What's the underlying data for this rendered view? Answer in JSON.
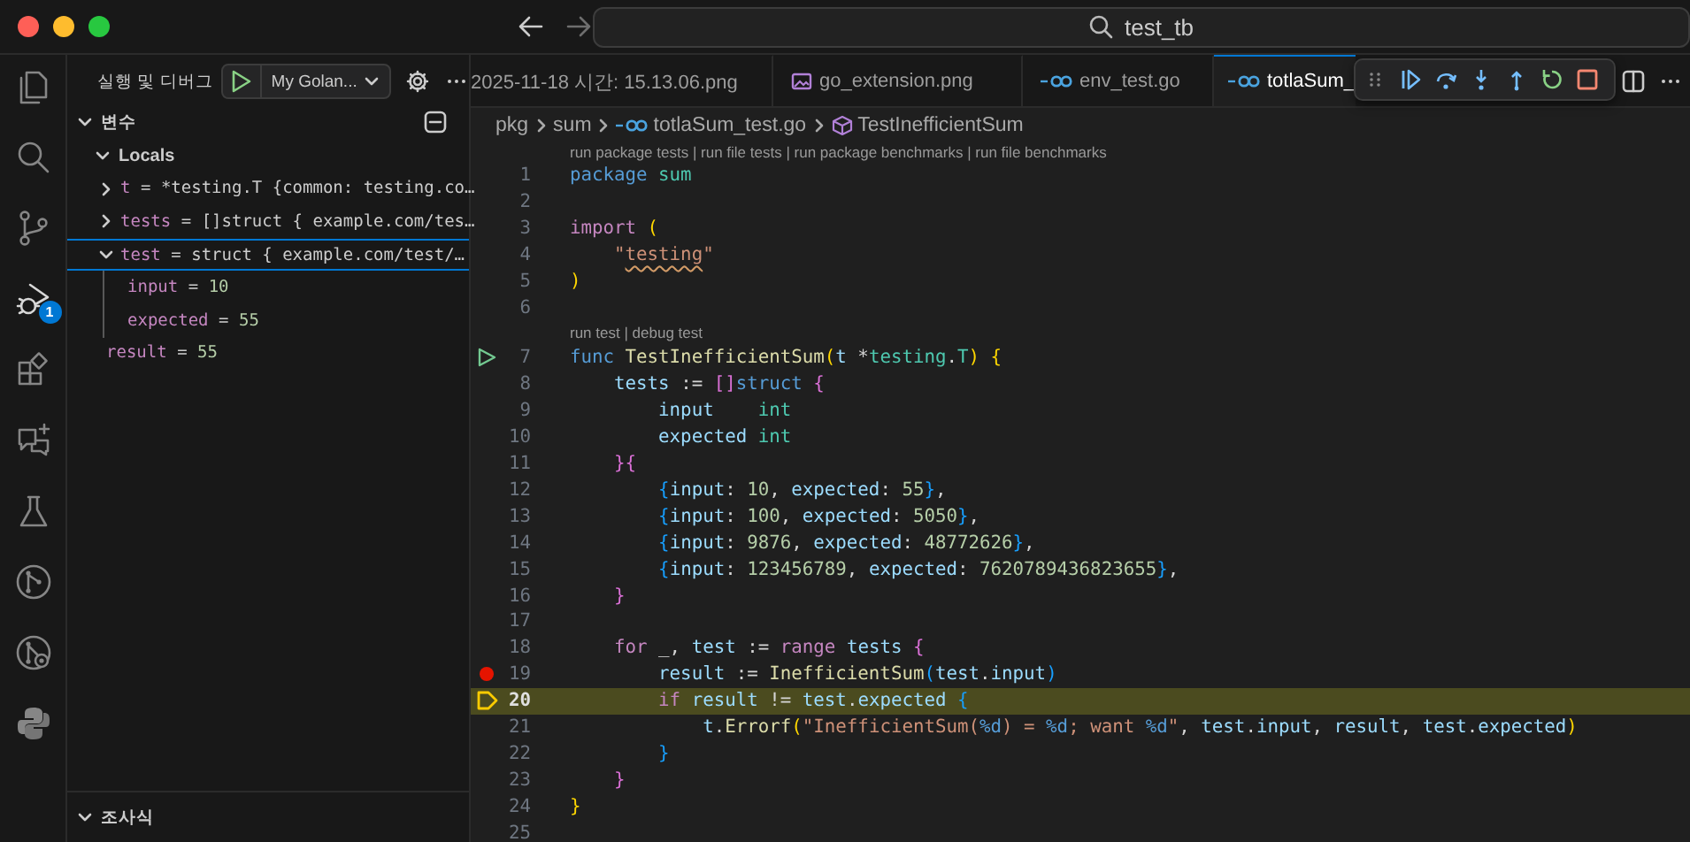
{
  "title_bar": {
    "command_center": "test_tb"
  },
  "activity_bar": [
    {
      "kind": "files",
      "selected": false
    },
    {
      "kind": "search",
      "selected": false
    },
    {
      "kind": "source-control",
      "selected": false
    },
    {
      "kind": "debug",
      "selected": true,
      "badge": "1"
    },
    {
      "kind": "extensions",
      "selected": false
    },
    {
      "kind": "chat",
      "selected": false
    },
    {
      "kind": "testing",
      "selected": false
    },
    {
      "kind": "git-graph",
      "selected": false
    },
    {
      "kind": "git-settings",
      "selected": false
    },
    {
      "kind": "python",
      "selected": false
    }
  ],
  "sidebar": {
    "title": "실행 및 디버그",
    "launch_config": "My Golan...",
    "variables": {
      "title": "변수",
      "expanded": true,
      "scopes": [
        {
          "name": "Locals",
          "expanded": true,
          "children": [
            {
              "name": "t",
              "operator": "=",
              "value": "*testing.T {common: testing.co…",
              "kind": "object",
              "expanded": false,
              "selected": false
            },
            {
              "name": "tests",
              "operator": "=",
              "value": "[]struct { example.com/tes…",
              "kind": "object",
              "expanded": false,
              "selected": false
            },
            {
              "name": "test",
              "operator": "=",
              "value": "struct { example.com/test/…",
              "kind": "object",
              "expanded": true,
              "selected": true,
              "children": [
                {
                  "name": "input",
                  "operator": "=",
                  "value": "10",
                  "kind": "number",
                  "selected": false
                },
                {
                  "name": "expected",
                  "operator": "=",
                  "value": "55",
                  "kind": "number",
                  "selected": false
                }
              ]
            },
            {
              "name": "result",
              "operator": "=",
              "value": "55",
              "kind": "number",
              "selected": false
            }
          ]
        }
      ]
    },
    "watch": {
      "title": "조사식",
      "expanded": true
    }
  },
  "tabs": [
    {
      "label": "2025-11-18 시간: 15.13.06.png",
      "selected": false
    },
    {
      "label": "go_extension.png",
      "kind": "image",
      "selected": false
    },
    {
      "label": "env_test.go",
      "kind": "go",
      "selected": false
    },
    {
      "label": "totlaSum_",
      "kind": "go",
      "selected": true
    }
  ],
  "breadcrumbs": [
    {
      "label": "pkg"
    },
    {
      "label": "sum"
    },
    {
      "label": "totlaSum_test.go",
      "kind": "go"
    },
    {
      "label": "TestInefficientSum",
      "kind": "symbol"
    }
  ],
  "lines": [
    {
      "kind": "codelens",
      "text": "run package tests | run file tests | run package benchmarks | run file benchmarks"
    },
    {
      "kind": "code",
      "number": "1",
      "highlighted": false,
      "tokens": [
        {
          "text": "package ",
          "kind": "decl"
        },
        {
          "text": "sum",
          "kind": "type"
        }
      ]
    },
    {
      "kind": "code",
      "number": "2",
      "highlighted": false
    },
    {
      "kind": "code",
      "number": "3",
      "highlighted": false,
      "tokens": [
        {
          "text": "import ",
          "kind": "ctrl"
        },
        {
          "text": "(",
          "kind": "b1"
        }
      ]
    },
    {
      "kind": "code",
      "number": "4",
      "highlighted": false,
      "tokens": [
        {
          "text": "    \"",
          "kind": "str"
        },
        {
          "text": "testing",
          "kind": "strline"
        },
        {
          "text": "\"",
          "kind": "str"
        }
      ]
    },
    {
      "kind": "code",
      "number": "5",
      "highlighted": false,
      "tokens": [
        {
          "text": ")",
          "kind": "b1"
        }
      ]
    },
    {
      "kind": "code",
      "number": "6",
      "highlighted": false
    },
    {
      "kind": "codelens",
      "text": "run test | debug test"
    },
    {
      "kind": "code",
      "number": "7",
      "highlighted": false,
      "gutter": {
        "kind": "run"
      },
      "tokens": [
        {
          "text": "func ",
          "kind": "decl"
        },
        {
          "text": "TestInefficientSum",
          "kind": "fn"
        },
        {
          "text": "(",
          "kind": "b1"
        },
        {
          "text": "t",
          "kind": "var"
        },
        {
          "text": " *",
          "kind": "op"
        },
        {
          "text": "testing",
          "kind": "type"
        },
        {
          "text": ".",
          "kind": "op"
        },
        {
          "text": "T",
          "kind": "type"
        },
        {
          "text": ")",
          "kind": "b1"
        },
        {
          "text": " {",
          "kind": "b1"
        }
      ]
    },
    {
      "kind": "code",
      "number": "8",
      "highlighted": false,
      "tokens": [
        {
          "text": "    tests",
          "kind": "var"
        },
        {
          "text": " := ",
          "kind": "op"
        },
        {
          "text": "[]",
          "kind": "b2"
        },
        {
          "text": "struct ",
          "kind": "decl"
        },
        {
          "text": "{",
          "kind": "b2"
        }
      ]
    },
    {
      "kind": "code",
      "number": "9",
      "highlighted": false,
      "tokens": [
        {
          "text": "        input    ",
          "kind": "var"
        },
        {
          "text": "int",
          "kind": "type"
        }
      ]
    },
    {
      "kind": "code",
      "number": "10",
      "highlighted": false,
      "tokens": [
        {
          "text": "        expected ",
          "kind": "var"
        },
        {
          "text": "int",
          "kind": "type"
        }
      ]
    },
    {
      "kind": "code",
      "number": "11",
      "highlighted": false,
      "tokens": [
        {
          "text": "    }{",
          "kind": "b2"
        }
      ]
    },
    {
      "kind": "code",
      "number": "12",
      "highlighted": false,
      "tokens": [
        {
          "text": "        {",
          "kind": "b3"
        },
        {
          "text": "input",
          "kind": "var"
        },
        {
          "text": ": ",
          "kind": "op"
        },
        {
          "text": "10",
          "kind": "num"
        },
        {
          "text": ", ",
          "kind": "op"
        },
        {
          "text": "expected",
          "kind": "var"
        },
        {
          "text": ": ",
          "kind": "op"
        },
        {
          "text": "55",
          "kind": "num"
        },
        {
          "text": "}",
          "kind": "b3"
        },
        {
          "text": ",",
          "kind": "op"
        }
      ]
    },
    {
      "kind": "code",
      "number": "13",
      "highlighted": false,
      "tokens": [
        {
          "text": "        {",
          "kind": "b3"
        },
        {
          "text": "input",
          "kind": "var"
        },
        {
          "text": ": ",
          "kind": "op"
        },
        {
          "text": "100",
          "kind": "num"
        },
        {
          "text": ", ",
          "kind": "op"
        },
        {
          "text": "expected",
          "kind": "var"
        },
        {
          "text": ": ",
          "kind": "op"
        },
        {
          "text": "5050",
          "kind": "num"
        },
        {
          "text": "}",
          "kind": "b3"
        },
        {
          "text": ",",
          "kind": "op"
        }
      ]
    },
    {
      "kind": "code",
      "number": "14",
      "highlighted": false,
      "tokens": [
        {
          "text": "        {",
          "kind": "b3"
        },
        {
          "text": "input",
          "kind": "var"
        },
        {
          "text": ": ",
          "kind": "op"
        },
        {
          "text": "9876",
          "kind": "num"
        },
        {
          "text": ", ",
          "kind": "op"
        },
        {
          "text": "expected",
          "kind": "var"
        },
        {
          "text": ": ",
          "kind": "op"
        },
        {
          "text": "48772626",
          "kind": "num"
        },
        {
          "text": "}",
          "kind": "b3"
        },
        {
          "text": ",",
          "kind": "op"
        }
      ]
    },
    {
      "kind": "code",
      "number": "15",
      "highlighted": false,
      "tokens": [
        {
          "text": "        {",
          "kind": "b3"
        },
        {
          "text": "input",
          "kind": "var"
        },
        {
          "text": ": ",
          "kind": "op"
        },
        {
          "text": "123456789",
          "kind": "num"
        },
        {
          "text": ", ",
          "kind": "op"
        },
        {
          "text": "expected",
          "kind": "var"
        },
        {
          "text": ": ",
          "kind": "op"
        },
        {
          "text": "7620789436823655",
          "kind": "num"
        },
        {
          "text": "}",
          "kind": "b3"
        },
        {
          "text": ",",
          "kind": "op"
        }
      ]
    },
    {
      "kind": "code",
      "number": "16",
      "highlighted": false,
      "tokens": [
        {
          "text": "    }",
          "kind": "b2"
        }
      ]
    },
    {
      "kind": "code",
      "number": "17",
      "highlighted": false
    },
    {
      "kind": "code",
      "number": "18",
      "highlighted": false,
      "tokens": [
        {
          "text": "    for",
          "kind": "ctrl"
        },
        {
          "text": " _, ",
          "kind": "op"
        },
        {
          "text": "test",
          "kind": "var"
        },
        {
          "text": " := ",
          "kind": "op"
        },
        {
          "text": "range ",
          "kind": "ctrl"
        },
        {
          "text": "tests ",
          "kind": "var"
        },
        {
          "text": "{",
          "kind": "b2"
        }
      ]
    },
    {
      "kind": "code",
      "number": "19",
      "highlighted": false,
      "gutter": {
        "kind": "breakpoint"
      },
      "tokens": [
        {
          "text": "        result",
          "kind": "var"
        },
        {
          "text": " := ",
          "kind": "op"
        },
        {
          "text": "InefficientSum",
          "kind": "fn"
        },
        {
          "text": "(",
          "kind": "b3"
        },
        {
          "text": "test",
          "kind": "var"
        },
        {
          "text": ".",
          "kind": "op"
        },
        {
          "text": "input",
          "kind": "var"
        },
        {
          "text": ")",
          "kind": "b3"
        }
      ]
    },
    {
      "kind": "code",
      "number": "20",
      "highlighted": true,
      "gutter": {
        "kind": "current"
      },
      "tokens": [
        {
          "text": "        if ",
          "kind": "ctrl"
        },
        {
          "text": "result",
          "kind": "var"
        },
        {
          "text": " != ",
          "kind": "op"
        },
        {
          "text": "test",
          "kind": "var"
        },
        {
          "text": ".",
          "kind": "op"
        },
        {
          "text": "expected ",
          "kind": "var"
        },
        {
          "text": "{",
          "kind": "b3"
        }
      ]
    },
    {
      "kind": "code",
      "number": "21",
      "highlighted": false,
      "tokens": [
        {
          "text": "            t",
          "kind": "var"
        },
        {
          "text": ".",
          "kind": "op"
        },
        {
          "text": "Errorf",
          "kind": "fn"
        },
        {
          "text": "(",
          "kind": "b1"
        },
        {
          "text": "\"InefficientSum(",
          "kind": "str"
        },
        {
          "text": "%d",
          "kind": "fmt"
        },
        {
          "text": ") = ",
          "kind": "str"
        },
        {
          "text": "%d",
          "kind": "fmt"
        },
        {
          "text": "; want ",
          "kind": "str"
        },
        {
          "text": "%d",
          "kind": "fmt"
        },
        {
          "text": "\"",
          "kind": "str"
        },
        {
          "text": ", ",
          "kind": "op"
        },
        {
          "text": "test",
          "kind": "var"
        },
        {
          "text": ".",
          "kind": "op"
        },
        {
          "text": "input",
          "kind": "var"
        },
        {
          "text": ", ",
          "kind": "op"
        },
        {
          "text": "result",
          "kind": "var"
        },
        {
          "text": ", ",
          "kind": "op"
        },
        {
          "text": "test",
          "kind": "var"
        },
        {
          "text": ".",
          "kind": "op"
        },
        {
          "text": "expected",
          "kind": "var"
        },
        {
          "text": ")",
          "kind": "b1"
        }
      ]
    },
    {
      "kind": "code",
      "number": "22",
      "highlighted": false,
      "tokens": [
        {
          "text": "        }",
          "kind": "b3"
        }
      ]
    },
    {
      "kind": "code",
      "number": "23",
      "highlighted": false,
      "tokens": [
        {
          "text": "    }",
          "kind": "b2"
        }
      ]
    },
    {
      "kind": "code",
      "number": "24",
      "highlighted": false,
      "tokens": [
        {
          "text": "}",
          "kind": "b1"
        }
      ]
    },
    {
      "kind": "code",
      "number": "25",
      "highlighted": false
    }
  ]
}
